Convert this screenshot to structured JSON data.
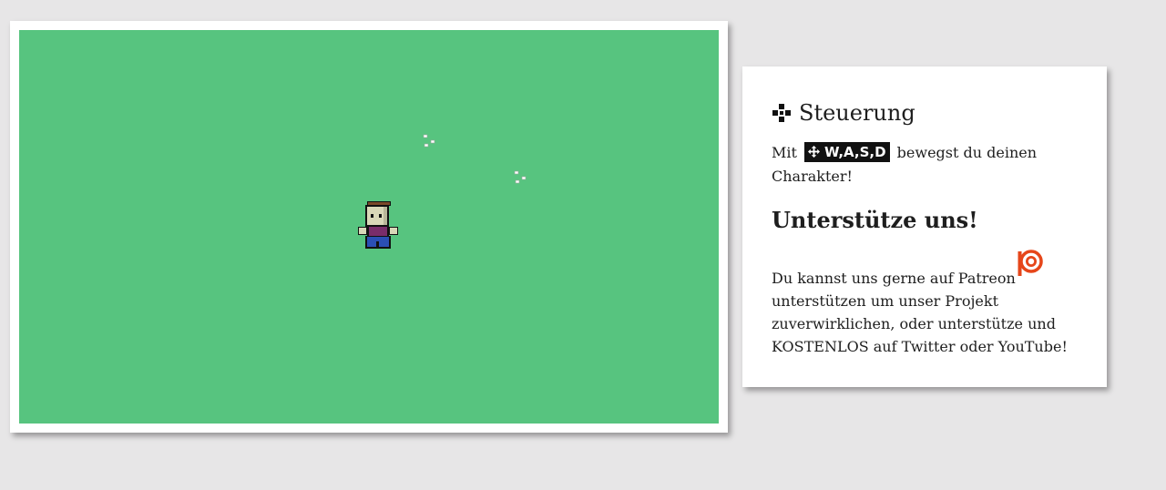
{
  "game": {
    "background_color": "#57c47f",
    "player_icon": "pixel-character",
    "flower_icon": "white-flower"
  },
  "controls": {
    "icon": "gamepad-icon",
    "heading": "Steuerung",
    "text_before": "Mit ",
    "key_icon": "move-arrows-icon",
    "keys": "W,A,S,D",
    "text_after": " bewegst du deinen Charakter!"
  },
  "support": {
    "heading": "Unterstütze uns!",
    "text_before": "Du kannst uns gerne auf Patreon",
    "patreon_icon": "patreon-icon",
    "patreon_color": "#e6461a",
    "text_after": " unterstützen um unser Projekt zuverwirklichen, oder unterstütze und KOSTENLOS auf Twitter oder YouTube!"
  }
}
